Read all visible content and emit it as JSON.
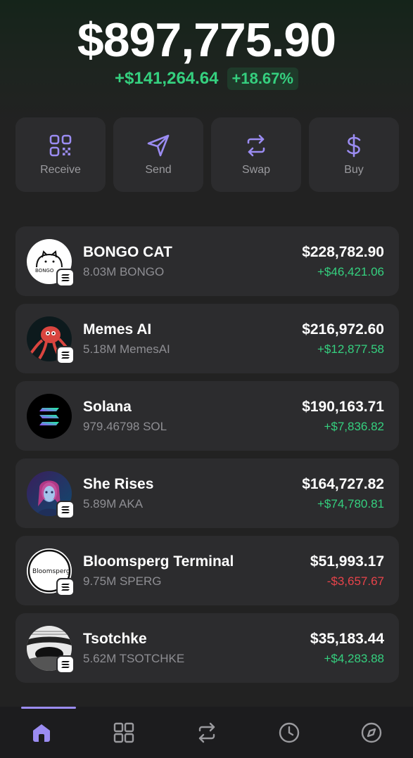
{
  "portfolio": {
    "balance": "$897,775.90",
    "change_abs": "+$141,264.64",
    "change_pct": "+18.67%"
  },
  "actions": [
    {
      "label": "Receive",
      "icon": "qr-code-icon"
    },
    {
      "label": "Send",
      "icon": "send-icon"
    },
    {
      "label": "Swap",
      "icon": "swap-icon"
    },
    {
      "label": "Buy",
      "icon": "dollar-icon"
    }
  ],
  "tokens": [
    {
      "name": "BONGO CAT",
      "amount": "8.03M BONGO",
      "value": "$228,782.90",
      "change": "+$46,421.06",
      "avatar_text": "BONGO"
    },
    {
      "name": "Memes AI",
      "amount": "5.18M MemesAI",
      "value": "$216,972.60",
      "change": "+$12,877.58"
    },
    {
      "name": "Solana",
      "amount": "979.46798 SOL",
      "value": "$190,163.71",
      "change": "+$7,836.82"
    },
    {
      "name": "She Rises",
      "amount": "5.89M AKA",
      "value": "$164,727.82",
      "change": "+$74,780.81"
    },
    {
      "name": "Bloomsperg Terminal",
      "amount": "9.75M SPERG",
      "value": "$51,993.17",
      "change": "-$3,657.67",
      "avatar_text": "Bloomsperg"
    },
    {
      "name": "Tsotchke",
      "amount": "5.62M TSOTCHKE",
      "value": "$35,183.44",
      "change": "+$4,283.88"
    }
  ],
  "tabs": [
    {
      "icon": "home-icon",
      "active": true
    },
    {
      "icon": "grid-icon",
      "active": false
    },
    {
      "icon": "swap-icon",
      "active": false
    },
    {
      "icon": "clock-icon",
      "active": false
    },
    {
      "icon": "compass-icon",
      "active": false
    }
  ],
  "colors": {
    "accent": "#9b8cf2",
    "positive": "#35d07f",
    "negative": "#e8434a",
    "card": "#2c2c2e",
    "background": "#222222"
  }
}
